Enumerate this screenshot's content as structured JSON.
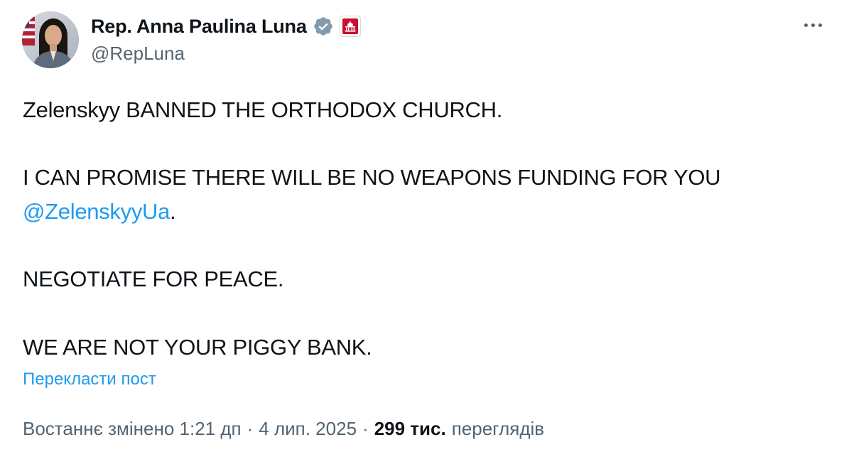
{
  "author": {
    "display_name": "Rep. Anna Paulina Luna",
    "handle": "@RepLuna",
    "verified_icon": "verified-badge-icon",
    "affiliation_icon": "capitol-badge-icon",
    "accent_color": "#1d9bf0",
    "badge_color": "#829aab",
    "affiliation_color": "#c8102e"
  },
  "tweet": {
    "line1": "Zelenskyy BANNED THE ORTHODOX CHURCH.",
    "line2": "I CAN PROMISE THERE WILL BE NO WEAPONS FUNDING FOR YOU",
    "mention": "@ZelenskyyUa",
    "mention_suffix": ".",
    "line3": "NEGOTIATE FOR PEACE.",
    "line4": "WE ARE NOT YOUR PIGGY BANK."
  },
  "actions": {
    "translate": "Перекласти пост",
    "more_icon": "more-horizontal-icon"
  },
  "meta": {
    "edited_time": "Востаннє змінено 1:21 дп",
    "separator": "·",
    "date": "4 лип. 2025",
    "views_count": "299 тис.",
    "views_label": "переглядів"
  }
}
